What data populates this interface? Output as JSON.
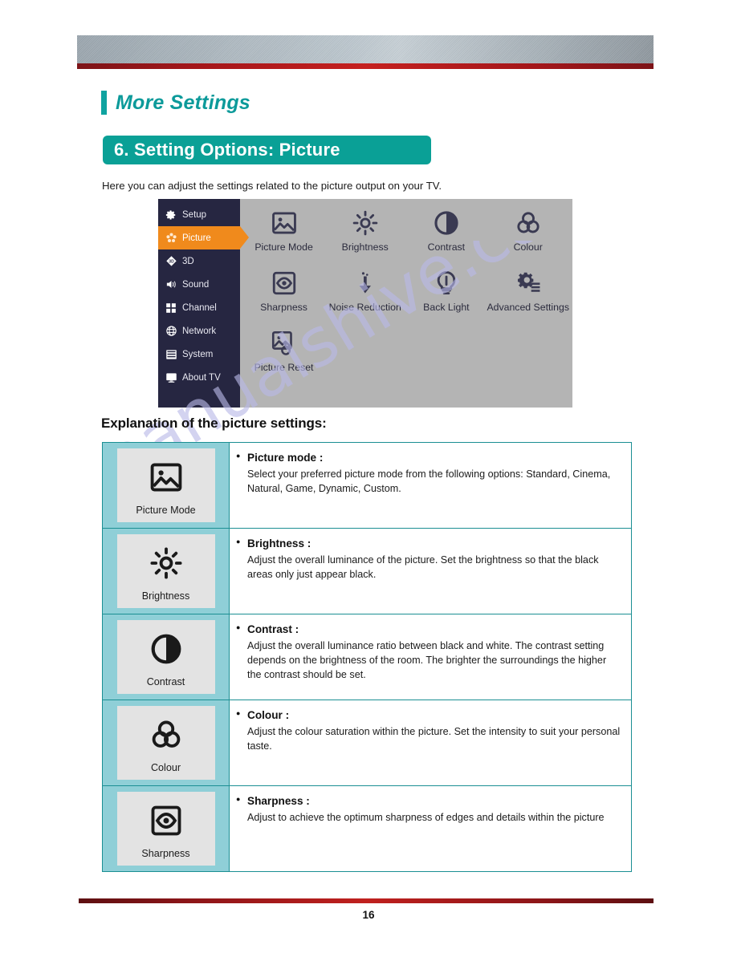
{
  "header": {
    "section_title": "More Settings",
    "page_title": "6. Setting Options: Picture",
    "intro": "Here you can adjust the settings related to the picture output on your TV.",
    "accent_teal": "#0aa096",
    "accent_red": "#c0201e"
  },
  "tv_menu": {
    "sidebar": [
      {
        "label": "Setup",
        "icon": "gear-icon",
        "selected": false
      },
      {
        "label": "Picture",
        "icon": "picture-flower-icon",
        "selected": true
      },
      {
        "label": "3D",
        "icon": "3d-diamond-icon",
        "selected": false
      },
      {
        "label": "Sound",
        "icon": "speaker-icon",
        "selected": false
      },
      {
        "label": "Channel",
        "icon": "grid-squares-icon",
        "selected": false
      },
      {
        "label": "Network",
        "icon": "globe-icon",
        "selected": false
      },
      {
        "label": "System",
        "icon": "window-bars-icon",
        "selected": false
      },
      {
        "label": "About TV",
        "icon": "monitor-icon",
        "selected": false
      }
    ],
    "tiles": [
      {
        "label": "Picture Mode",
        "icon": "image-mountain-icon"
      },
      {
        "label": "Brightness",
        "icon": "sun-rays-icon"
      },
      {
        "label": "Contrast",
        "icon": "half-filled-circle-icon"
      },
      {
        "label": "Colour",
        "icon": "three-circles-icon"
      },
      {
        "label": "Sharpness",
        "icon": "eye-in-square-icon"
      },
      {
        "label": "Noise Reduction",
        "icon": "down-arrow-icon"
      },
      {
        "label": "Back Light",
        "icon": "light-bulb-icon"
      },
      {
        "label": "Advanced Settings",
        "icon": "gear-lines-icon"
      },
      {
        "label": "Picture Reset",
        "icon": "image-reset-icon"
      }
    ],
    "selected_highlight_color": "#f08a1c",
    "sidebar_bg": "#262641",
    "panel_bg": "#b4b4b4"
  },
  "explanation": {
    "heading": "Explanation of the picture settings:",
    "rows": [
      {
        "icon": "image-mountain-icon",
        "icon_label": "Picture Mode",
        "title": "Picture mode :",
        "body": "Select your preferred picture mode from the following options: Standard, Cinema, Natural, Game, Dynamic, Custom."
      },
      {
        "icon": "sun-rays-icon",
        "icon_label": "Brightness",
        "title": "Brightness :",
        "body": "Adjust the overall luminance of the picture. Set the brightness so that the black areas only just appear black."
      },
      {
        "icon": "half-filled-circle-icon",
        "icon_label": "Contrast",
        "title": "Contrast :",
        "body": "Adjust the overall luminance ratio between black and white. The contrast setting depends on the brightness of the room. The brighter the surroundings the higher the contrast should be set."
      },
      {
        "icon": "three-circles-icon",
        "icon_label": "Colour",
        "title": "Colour :",
        "body": "Adjust the colour saturation within the picture. Set the intensity to suit your personal taste."
      },
      {
        "icon": "eye-in-square-icon",
        "icon_label": "Sharpness",
        "title": "Sharpness :",
        "body": "Adjust to achieve the optimum sharpness of edges and details within the picture"
      }
    ]
  },
  "footer": {
    "page_number": "16"
  },
  "watermark": {
    "text": "manualshive.com"
  }
}
